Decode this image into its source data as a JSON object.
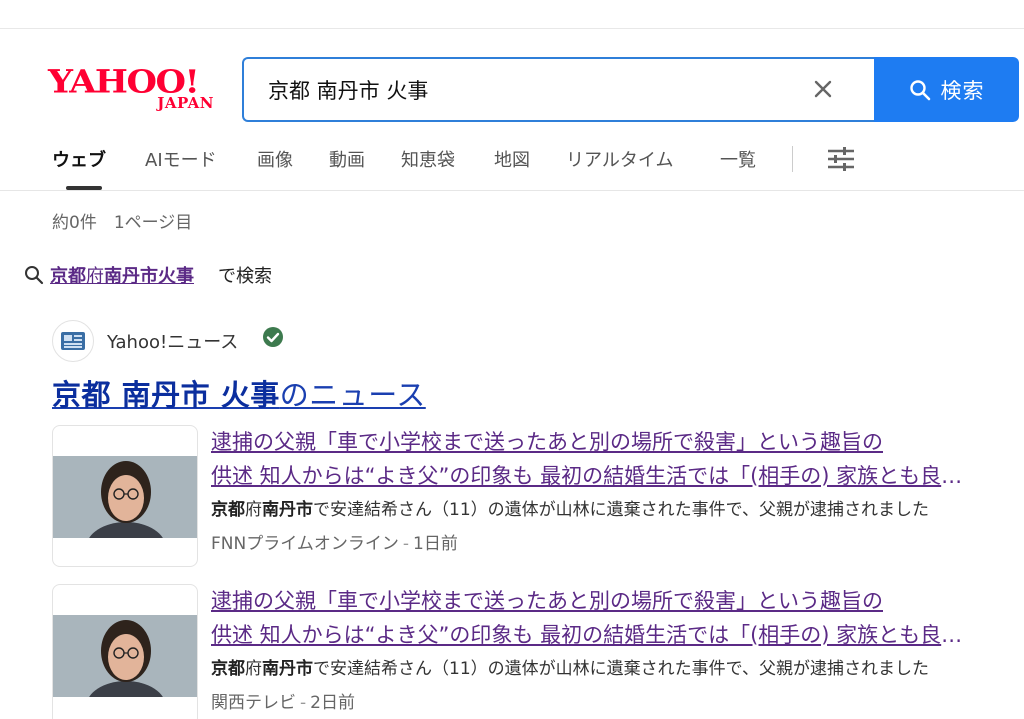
{
  "logo": {
    "main": "YAHOO!",
    "sub": "JAPAN"
  },
  "search": {
    "query": "京都 南丹市 火事",
    "button_label": "検索"
  },
  "tabs": [
    {
      "label": "ウェブ",
      "active": true
    },
    {
      "label": "AIモード"
    },
    {
      "label": "画像"
    },
    {
      "label": "動画"
    },
    {
      "label": "知恵袋"
    },
    {
      "label": "地図"
    },
    {
      "label": "リアルタイム"
    },
    {
      "label": "一覧"
    }
  ],
  "result_count": "約0件　1ページ目",
  "suggestion": {
    "link_b1": "京都",
    "link_plain": "府",
    "link_b2": "南丹市火事",
    "tail": "で検索"
  },
  "news": {
    "source_name": "Yahoo!ニュース",
    "heading_query": "京都 南丹市 火事",
    "heading_suffix": "のニュース",
    "items": [
      {
        "title_line1": "逮捕の父親「車で小学校まで送ったあと別の場所で殺害」という趣旨の",
        "title_line2": "供述 知人からは“よき父”の印象も 最初の結婚生活では「(相手の) 家族とも良好」",
        "snip_b1": "京都",
        "snip_p1": "府",
        "snip_b2": "南丹市",
        "snip_rest": "で安達結希さん（11）の遺体が山林に遺棄された事件で、父親が逮捕されました",
        "source": "FNNプライムオンライン",
        "time": "1日前"
      },
      {
        "title_line1": "逮捕の父親「車で小学校まで送ったあと別の場所で殺害」という趣旨の",
        "title_line2": "供述 知人からは“よき父”の印象も 最初の結婚生活では「(相手の) 家族とも良好」",
        "snip_b1": "京都",
        "snip_p1": "府",
        "snip_b2": "南丹市",
        "snip_rest": "で安達結希さん（11）の遺体が山林に遺棄された事件で、父親が逮捕されました",
        "source": "関西テレビ",
        "time": "2日前"
      }
    ]
  },
  "colors": {
    "brand_red": "#ff0033",
    "accent_blue": "#1e7cf2",
    "visited_link": "#5b2a86",
    "heading_link": "#1a3fb0"
  }
}
